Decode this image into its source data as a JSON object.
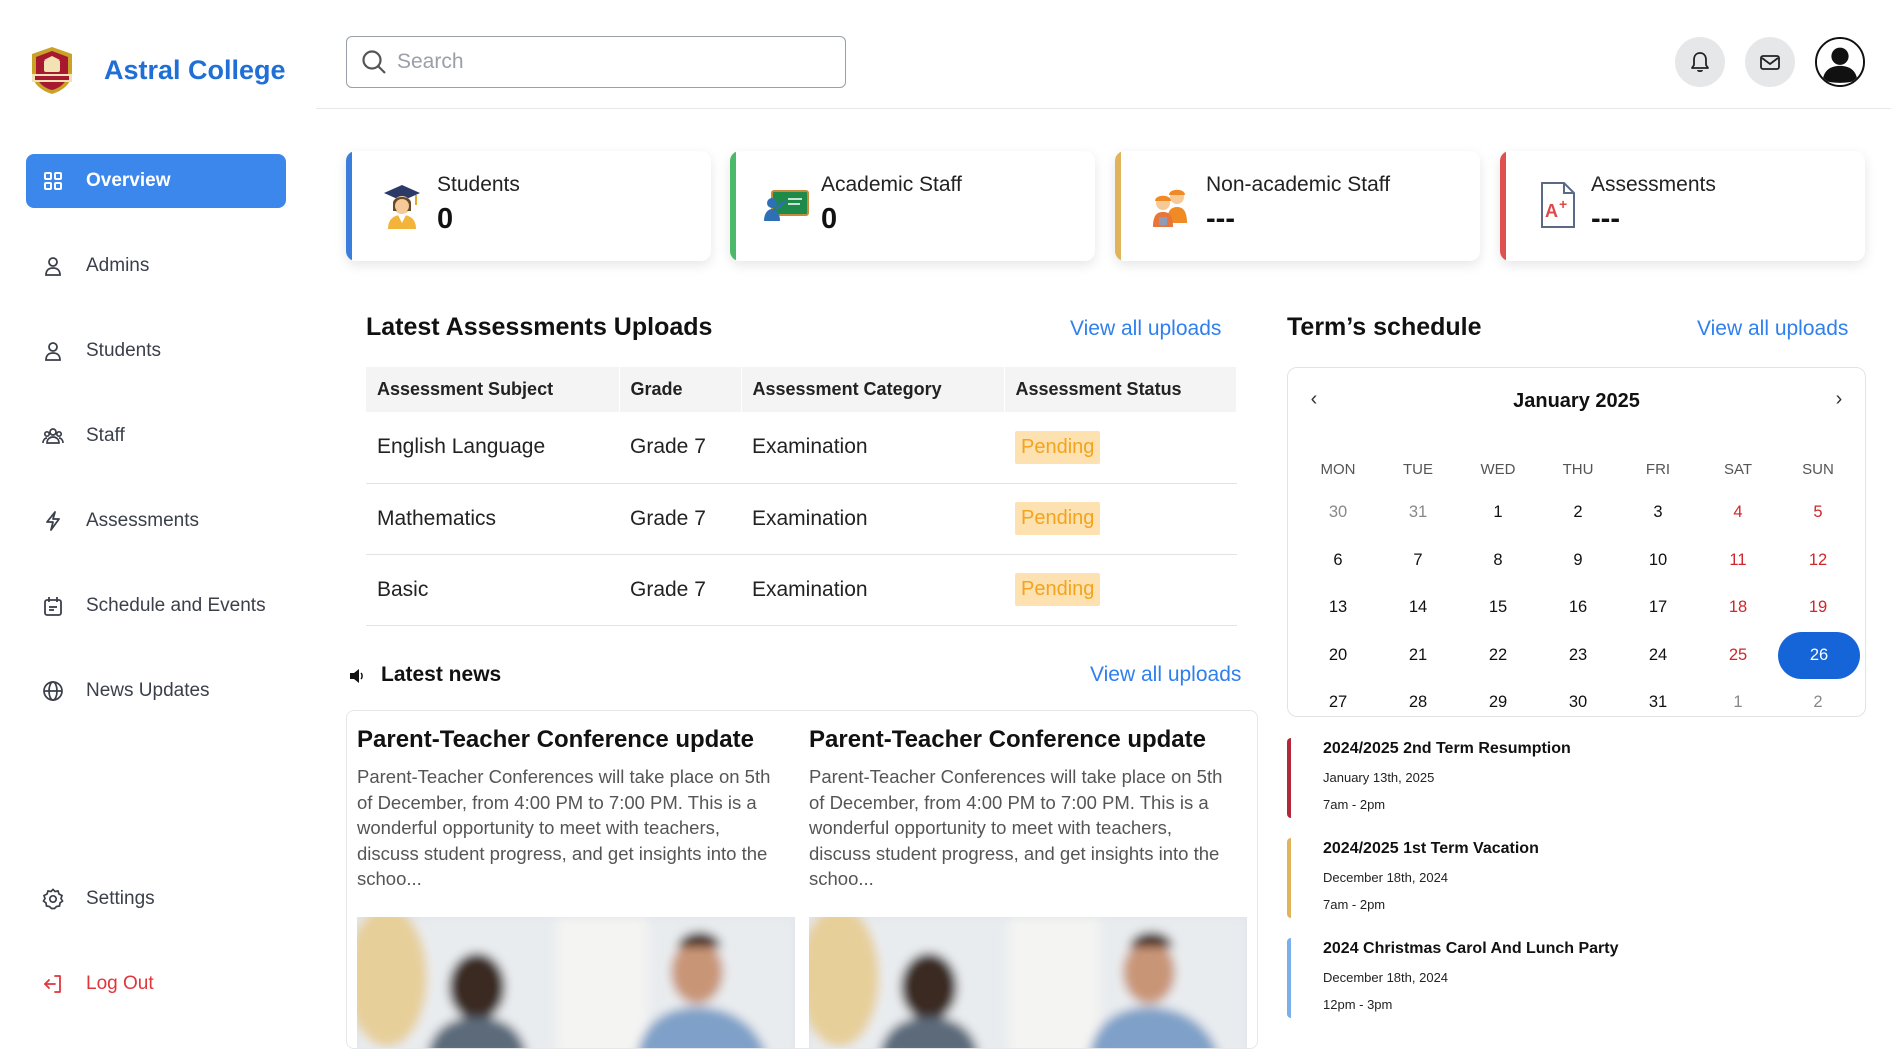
{
  "brand": {
    "name": "Astral College"
  },
  "sidebar": {
    "items": [
      {
        "label": "Overview",
        "icon": "grid-icon"
      },
      {
        "label": "Admins",
        "icon": "user-icon"
      },
      {
        "label": "Students",
        "icon": "user-icon"
      },
      {
        "label": "Staff",
        "icon": "group-icon"
      },
      {
        "label": "Assessments",
        "icon": "bolt-icon"
      },
      {
        "label": "Schedule and Events",
        "icon": "calendar-icon"
      },
      {
        "label": "News Updates",
        "icon": "globe-icon"
      }
    ],
    "settings_label": "Settings",
    "logout_label": "Log Out"
  },
  "topbar": {
    "search_placeholder": "Search"
  },
  "stats": [
    {
      "label": "Students",
      "value": "0",
      "color": "#3b7ddd"
    },
    {
      "label": "Academic Staff",
      "value": "0",
      "color": "#4cb86a"
    },
    {
      "label": "Non-academic Staff",
      "value": "---",
      "color": "#e0b45a"
    },
    {
      "label": "Assessments",
      "value": "---",
      "color": "#e05050"
    }
  ],
  "assessments": {
    "title": "Latest Assessments Uploads",
    "view_all": "View all uploads",
    "columns": [
      "Assessment Subject",
      "Grade",
      "Assessment Category",
      "Assessment Status"
    ],
    "rows": [
      {
        "subject": "English Language",
        "grade": "Grade 7",
        "category": "Examination",
        "status": "Pending"
      },
      {
        "subject": "Mathematics",
        "grade": "Grade 7",
        "category": "Examination",
        "status": "Pending"
      },
      {
        "subject": "Basic",
        "grade": "Grade 7",
        "category": "Examination",
        "status": "Pending"
      }
    ]
  },
  "news": {
    "title": "Latest news",
    "view_all": "View all uploads",
    "items": [
      {
        "title": "Parent-Teacher Conference update",
        "body": "Parent-Teacher Conferences will take place on 5th of December, from 4:00 PM to 7:00 PM. This is a wonderful opportunity to meet with teachers, discuss student progress, and get insights into the schoo..."
      },
      {
        "title": "Parent-Teacher Conference update",
        "body": "Parent-Teacher Conferences will take place on 5th of December, from 4:00 PM to 7:00 PM. This is a wonderful opportunity to meet with teachers, discuss student progress, and get insights into the schoo..."
      }
    ]
  },
  "schedule": {
    "title": "Term’s schedule",
    "view_all": "View all uploads",
    "month": "January 2025",
    "prev": "‹",
    "next": "›",
    "weekdays": [
      "MON",
      "TUE",
      "WED",
      "THU",
      "FRI",
      "SAT",
      "SUN"
    ],
    "days": [
      "30",
      "31",
      "1",
      "2",
      "3",
      "4",
      "5",
      "6",
      "7",
      "8",
      "9",
      "10",
      "11",
      "12",
      "13",
      "14",
      "15",
      "16",
      "17",
      "18",
      "19",
      "20",
      "21",
      "22",
      "23",
      "24",
      "25",
      "26",
      "27",
      "28",
      "29",
      "30",
      "31",
      "1",
      "2"
    ],
    "selected_day": "26",
    "events": [
      {
        "title": "2024/2025 2nd Term Resumption",
        "date": "January 13th, 2025",
        "time": "7am - 2pm",
        "color": "#b2283a"
      },
      {
        "title": "2024/2025 1st Term Vacation",
        "date": "December 18th, 2024",
        "time": "7am - 2pm",
        "color": "#e0b45a"
      },
      {
        "title": "2024 Christmas Carol And Lunch Party",
        "date": "December 18th, 2024",
        "time": "12pm - 3pm",
        "color": "#7ab0e8"
      }
    ]
  }
}
